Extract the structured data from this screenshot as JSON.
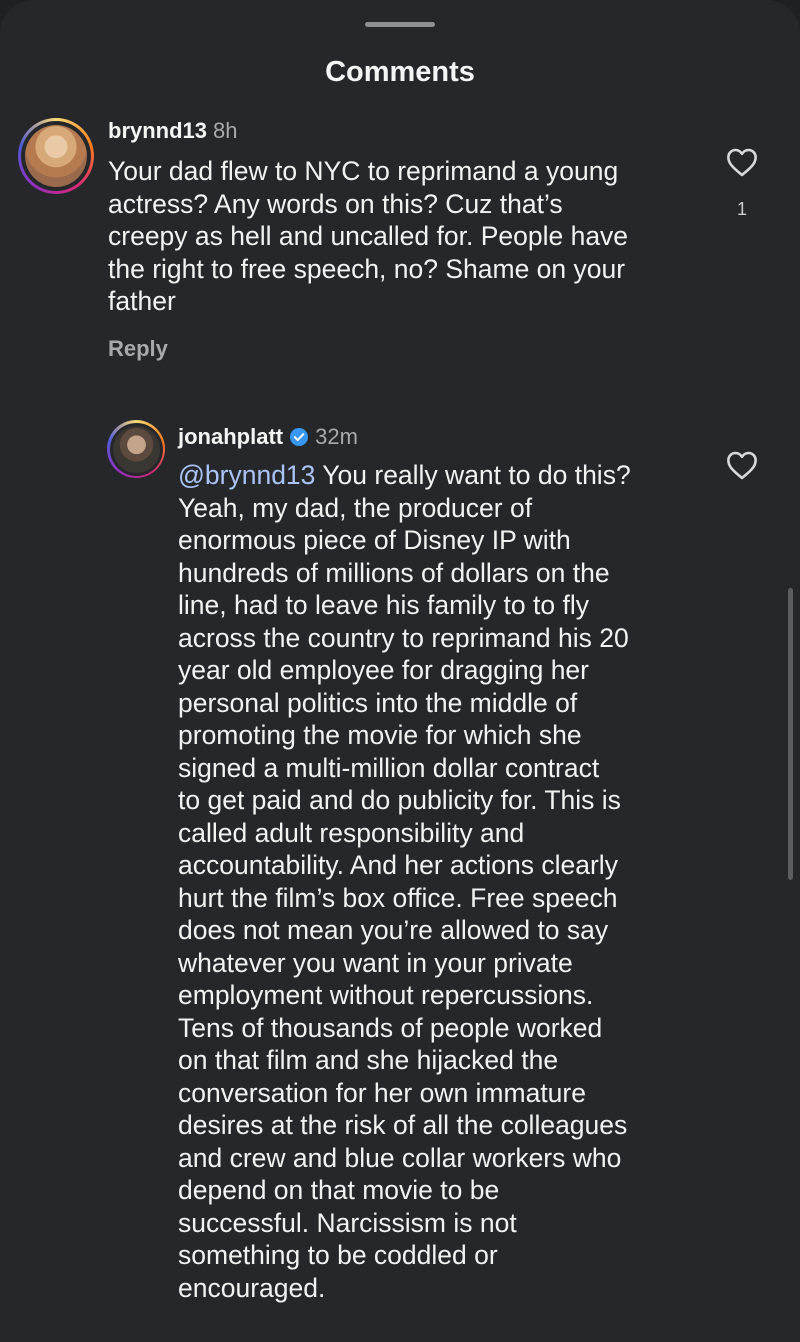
{
  "sheet": {
    "title": "Comments"
  },
  "comments": [
    {
      "username": "brynnd13",
      "time": "8h",
      "text_lines": [
        "Your dad flew to NYC to reprimand a young",
        "actress? Any words on this? Cuz that’s",
        "creepy as hell and uncalled for. People have",
        "the right to free speech, no? Shame on your",
        "father"
      ],
      "reply_label": "Reply",
      "like_count": "1",
      "avatar_icon": "profile-photo"
    },
    {
      "username": "jonahplatt",
      "verified": true,
      "time": "32m",
      "mention": "@brynnd13",
      "text_first_line_rest": " You really want to do this?",
      "text_lines": [
        "Yeah, my dad, the producer of",
        "enormous piece of Disney IP with",
        "hundreds of millions of dollars on the",
        "line, had to leave his family to to fly",
        "across the country to reprimand his 20",
        "year old employee for dragging her",
        "personal politics into the middle of",
        "promoting the movie for which she",
        "signed a multi-million dollar contract",
        "to get paid and do publicity for. This is",
        "called adult responsibility and",
        "accountability. And her actions clearly",
        "hurt the film’s box office. Free speech",
        "does not mean you’re allowed to say",
        "whatever you want in your private",
        "employment without repercussions.",
        "Tens of thousands of people worked",
        "on that film and she hijacked the",
        "conversation for her own immature",
        "desires at the risk of all the colleagues",
        "and crew and blue collar workers who",
        "depend on that movie to be",
        "successful. Narcissism is not",
        "something to be coddled or",
        "encouraged."
      ],
      "avatar_icon": "profile-photo"
    }
  ],
  "icons": {
    "like": "heart-outline-icon",
    "verified": "verified-badge-icon"
  },
  "colors": {
    "background": "#26272b",
    "mention": "#a9c4f5",
    "verified": "#3897f0",
    "secondary_text": "#a8a9ad"
  }
}
